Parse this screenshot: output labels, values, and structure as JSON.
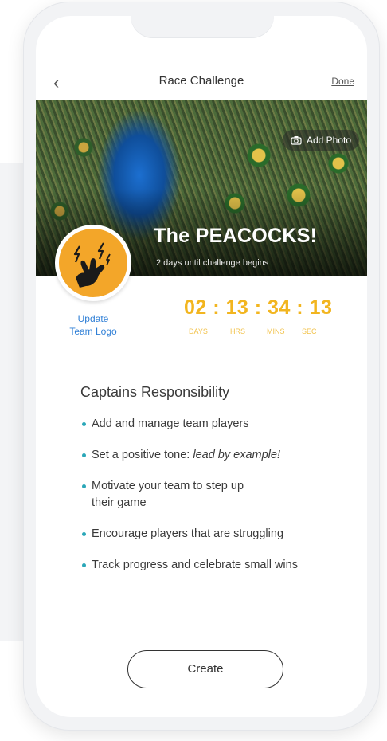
{
  "nav": {
    "back_icon": "chevron-left-icon",
    "back_glyph": "‹",
    "title": "Race Challenge",
    "done_label": "Done"
  },
  "hero": {
    "add_photo_label": "Add Photo",
    "team_name": "The PEACOCKS!",
    "countdown_caption": "2 days until challenge begins"
  },
  "logo": {
    "update_label_line1": "Update",
    "update_label_line2": "Team Logo",
    "icon": "rock-hand-icon"
  },
  "timer": {
    "display": "02 : 13 : 34 : 13",
    "labels": [
      "DAYS",
      "HRS",
      "MINS",
      "SEC"
    ]
  },
  "responsibilities": {
    "title": "Captains Responsibility",
    "items": [
      {
        "text": "Add and manage team players"
      },
      {
        "text_prefix": "Set a positive tone: ",
        "text_emph": "lead by example!"
      },
      {
        "text_line1": "Motivate your team to step up",
        "text_line2": "their game"
      },
      {
        "text": "Encourage players that are struggling"
      },
      {
        "text": "Track progress and celebrate small wins"
      }
    ]
  },
  "create_label": "Create",
  "colors": {
    "accent_gold": "#f2b51f",
    "logo_orange": "#f3a629",
    "link_blue": "#2f7fd6",
    "bullet_teal": "#2aa7b8"
  }
}
